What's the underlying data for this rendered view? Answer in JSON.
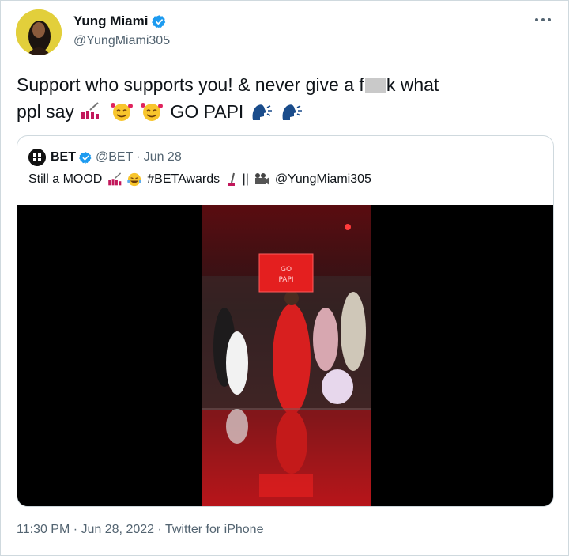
{
  "author": {
    "name": "Yung Miami",
    "handle": "@YungMiami305",
    "avatar_icon": "profile-photo"
  },
  "tweet": {
    "part1": "Support who supports you! & never give a f",
    "part2": "k what",
    "part3": "ppl say",
    "part4": "GO PAPI"
  },
  "quote": {
    "name": "BET",
    "handle": "@BET",
    "separator": "·",
    "date": "Jun 28",
    "text_part1": "Still a MOOD",
    "text_part2": "#BETAwards",
    "text_part3": "||",
    "text_part4": "@YungMiami305",
    "sign_text": "GO PAPI"
  },
  "footer": {
    "timestamp": "11:30 PM · Jun 28, 2022 · Twitter for iPhone"
  },
  "colors": {
    "verified": "#1d9bf0",
    "muted": "#536471",
    "text": "#0f1419",
    "border": "#cfd9de",
    "stage_red": "#d81f1f"
  }
}
